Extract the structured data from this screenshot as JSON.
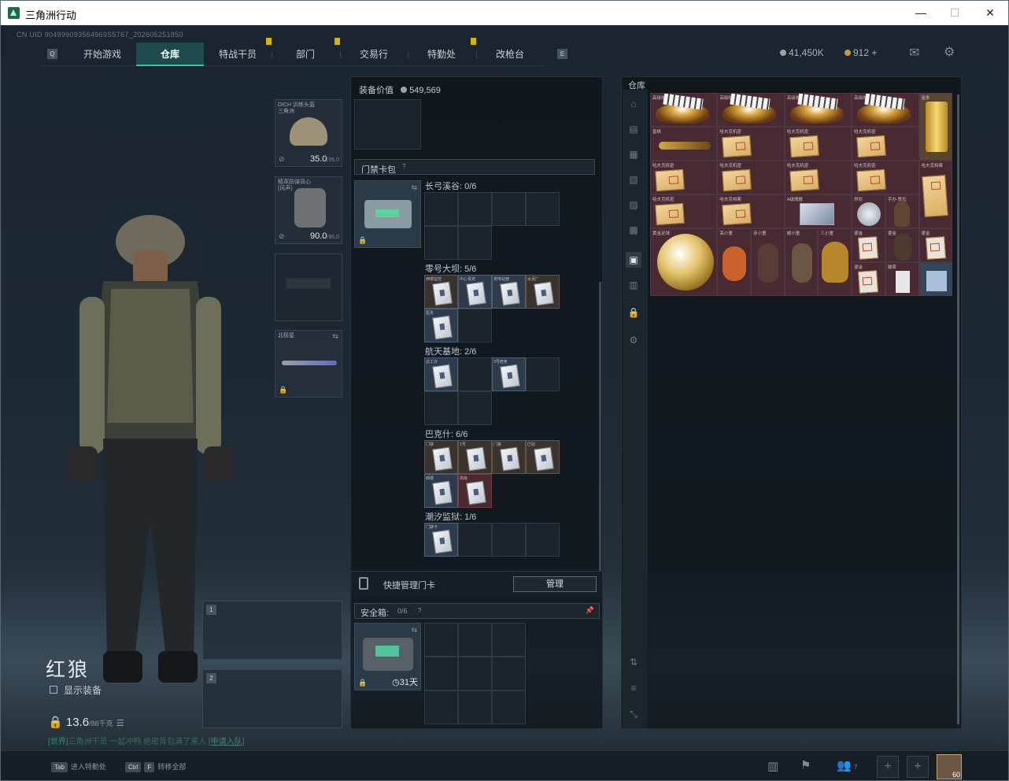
{
  "window": {
    "title": "三角洲行动",
    "min": "—",
    "max": "☐",
    "close": "✕"
  },
  "uid": "CN UID 904999093564969S5767_202605251850",
  "nav": {
    "left_key": "Q",
    "right_key": "E",
    "tabs": [
      "开始游戏",
      "仓库",
      "特战干员",
      "部门",
      "交易行",
      "特勤处",
      "改枪台"
    ],
    "active": "仓库"
  },
  "currency": {
    "coins": "41,450K",
    "points": "912",
    "plus": "+"
  },
  "loadout": {
    "helmet": {
      "name": "DICH 训练头盔",
      "sub": "三角洲",
      "durability": "35.0",
      "max": "/35.0"
    },
    "armor": {
      "name": "精英防弹背心",
      "sub": "(风声)",
      "durability": "90.0",
      "max": "/90.0"
    },
    "melee": {
      "name": "北极星"
    },
    "weapon_slot1": "1",
    "weapon_slot2": "2"
  },
  "character": {
    "name": "红狼",
    "show_gear": "显示装备",
    "weight": "13.6",
    "weight_max": "/88千克",
    "hint_prefix": "[世界]",
    "hint_text": "三角洲干员 一起冲鸭 绝密背包满了来人",
    "hint_link": "[申请入队]"
  },
  "gear_value": {
    "label": "装备价值",
    "value": "549,569"
  },
  "keycard": {
    "title": "门禁卡包",
    "help": "?",
    "maps": [
      {
        "name": "长弓溪谷:",
        "count": "0/6"
      },
      {
        "name": "零号大坝:",
        "count": "5/6"
      },
      {
        "name": "航天基地:",
        "count": "2/6"
      },
      {
        "name": "巴克什:",
        "count": "6/6"
      },
      {
        "name": "潮汐监狱:",
        "count": "1/6"
      }
    ],
    "quick": "快捷管理门卡",
    "manage": "管理"
  },
  "card_caps": {
    "dam": [
      "西楼监控",
      "中心贵宾",
      "变电站宿",
      "水泥厂",
      "医务"
    ],
    "space": [
      "总工办",
      "3号宿舍"
    ],
    "bakesh": [
      "门禁",
      "1号",
      "门禁",
      "巴别",
      "西楼",
      "高级"
    ],
    "prison": [
      "门禁卡"
    ]
  },
  "safebox": {
    "title": "安全箱:",
    "count": "0/6",
    "help": "?",
    "pin": "📌",
    "days": "31天"
  },
  "warehouse": {
    "title": "仓库",
    "labels": [
      "高级咖啡豆",
      "高级咖啡豆",
      "高级咖啡豆",
      "高级咖啡豆",
      "金条",
      "香槟",
      "哈夫克机密",
      "哈夫克机密",
      "哈夫克机密",
      "哈夫克机密",
      "哈夫克机密",
      "哈夫克机密",
      "哈夫克机密",
      "哈夫克机密",
      "哈夫克档案",
      "哈夫克档案",
      "哈夫克档案",
      "A级情报",
      "异形",
      "手办·赞拉",
      "黄金足球",
      "高小童",
      "赤小童",
      "威小童",
      "三小童",
      "鎏金",
      "鎏金",
      "鎏金",
      "鎏金",
      "徽章"
    ]
  },
  "bottom": {
    "k1": "Tab",
    "t1": "进入特勤处",
    "k2": "Ctrl",
    "k3": "F",
    "t2": "转移全部",
    "avatar_level": "60",
    "social_count": "7"
  }
}
